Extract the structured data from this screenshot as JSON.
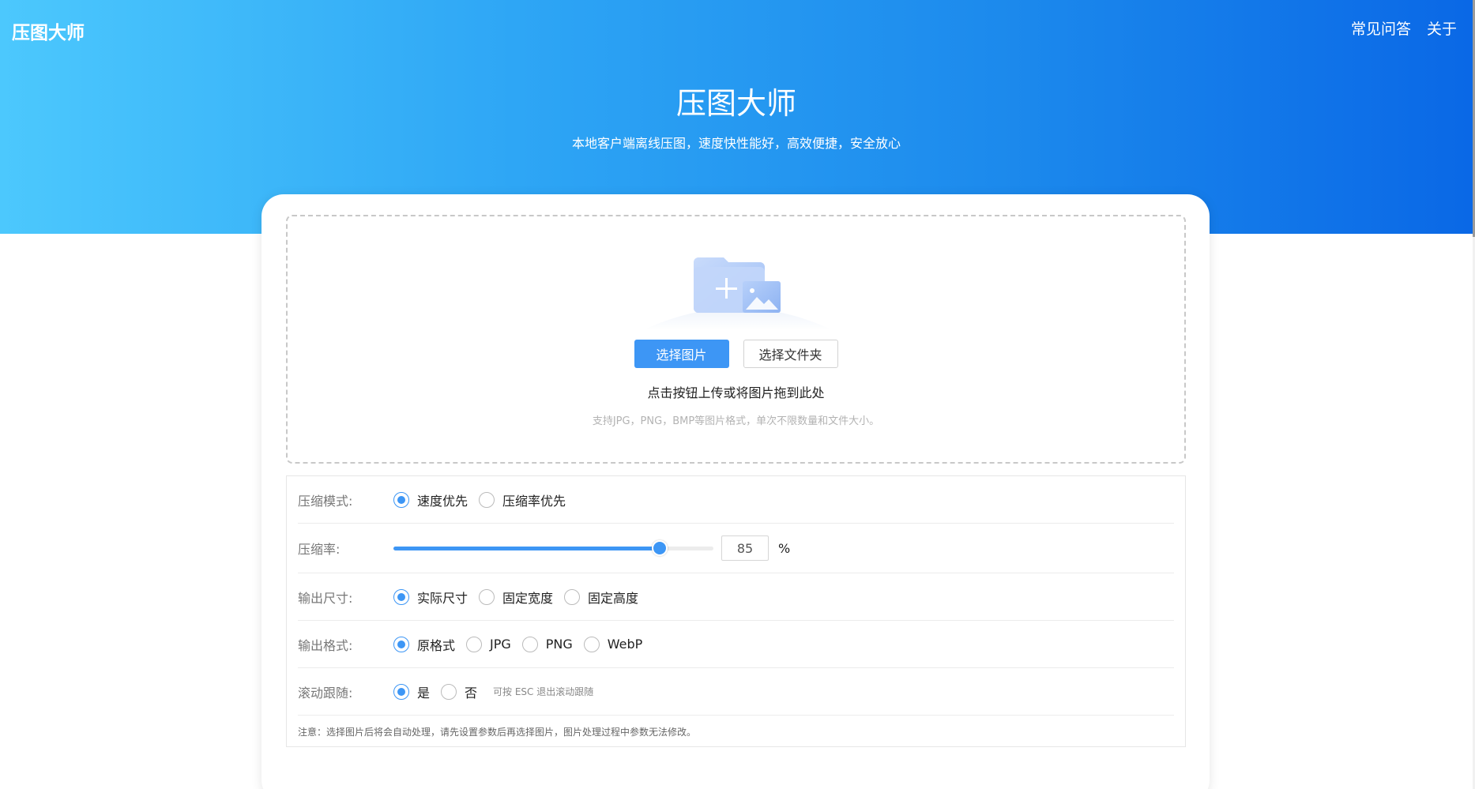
{
  "header": {
    "brand": "压图大师",
    "nav": [
      "常见问答",
      "关于"
    ],
    "title": "压图大师",
    "subtitle": "本地客户端离线压图，速度快性能好，高效便捷，安全放心"
  },
  "colors": {
    "hero_gradient": [
      "#4cc8fd",
      "#0a68e6"
    ],
    "accent": "#3d96f5"
  },
  "upload": {
    "illustration_icon": "folder-add-image-icon",
    "select_image_label": "选择图片",
    "select_folder_label": "选择文件夹",
    "hint": "点击按钮上传或将图片拖到此处",
    "support": "支持JPG，PNG，BMP等图片格式，单次不限数量和文件大小。"
  },
  "settings": {
    "mode": {
      "label": "压缩模式:",
      "options": [
        "速度优先",
        "压缩率优先"
      ],
      "selected": "速度优先"
    },
    "rate": {
      "label": "压缩率:",
      "value": 85,
      "min": 0,
      "max": 100,
      "unit": "%"
    },
    "size": {
      "label": "输出尺寸:",
      "options": [
        "实际尺寸",
        "固定宽度",
        "固定高度"
      ],
      "selected": "实际尺寸"
    },
    "format": {
      "label": "输出格式:",
      "options": [
        "原格式",
        "JPG",
        "PNG",
        "WebP"
      ],
      "selected": "原格式"
    },
    "follow": {
      "label": "滚动跟随:",
      "options": [
        "是",
        "否"
      ],
      "selected": "是",
      "tip": "可按 ESC 退出滚动跟随"
    },
    "note": "注意：选择图片后将会自动处理，请先设置参数后再选择图片，图片处理过程中参数无法修改。"
  }
}
